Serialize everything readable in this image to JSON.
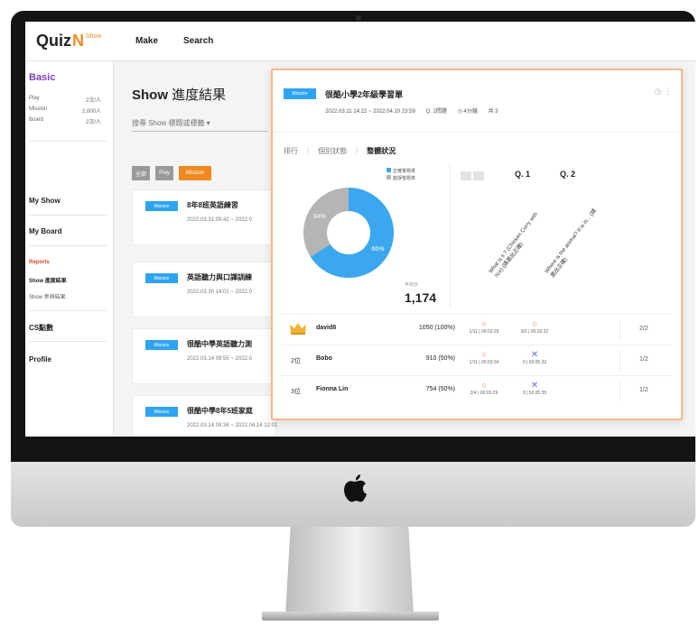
{
  "app": {
    "logo_text": "Quiz",
    "logo_mark": "N",
    "logo_badge": "Show",
    "nav": [
      "Make",
      "Search"
    ]
  },
  "sidebar": {
    "plan_title": "Basic",
    "plan_rows": [
      {
        "label": "Play",
        "value": "2次/人"
      },
      {
        "label": "Mission",
        "value": "2,000人"
      },
      {
        "label": "Board",
        "value": "2次/人"
      }
    ],
    "items": [
      "My Show",
      "My Board"
    ],
    "reports_label": "Reports",
    "report_subs": [
      "Show 進度結果",
      "Show 參與結果"
    ],
    "extra_items": [
      "CS點數",
      "Profile"
    ]
  },
  "main": {
    "title_prefix": "Show",
    "title_zh": "進度結果",
    "search_placeholder": "搜尋 Show 標題或標籤 ▾",
    "filters": [
      "全部",
      "Play",
      "Mission"
    ],
    "cards": [
      {
        "tag": "Mission",
        "title": "8年8班英語練習",
        "date": "2022.03.31 09:42 ~ 2022.0"
      },
      {
        "tag": "Mission",
        "title": "英語聽力與口譯訓練",
        "date": "2022.03.30 14:01 ~ 2022.0"
      },
      {
        "tag": "Mission",
        "title": "很酷中學英語聽力測",
        "date": "2022.03.14 09:55 ~ 2022.0"
      },
      {
        "tag": "Mission",
        "title": "很酷中學8年5班家庭",
        "date": "2022.03.14 09:36 ~ 2022.04.14 12:01"
      }
    ]
  },
  "report": {
    "tag": "Mission",
    "title": "很酷小學2年級學習單",
    "meta": [
      "2022.03.11 14:22 ~ 2022.04.10 23:59",
      "Q. 2問題",
      "◷ 4分鐘",
      "共 3"
    ],
    "menu_icon": "◷ ⋮",
    "tabs": [
      "排行",
      "個別狀態",
      "整體狀況"
    ],
    "active_tab_index": 2,
    "legend": [
      "正確答題率",
      "錯誤答題率"
    ],
    "avg_label": "平均分",
    "avg_value": "1,174",
    "question_heads": [
      "Q. 1",
      "Q. 2"
    ],
    "question_texts": [
      "What is it ? (Chicken Curry with rice) (請選出正確)",
      "Where is the animal? It is in... (請選出正確)"
    ],
    "rows": [
      {
        "rank": "",
        "name": "david8",
        "score": "1050 (100%)",
        "q1": {
          "mark": "○",
          "time": "1/11 | 00:03:29"
        },
        "q2": {
          "mark": "○",
          "time": "9/2 | 00:02:32"
        },
        "total": "2/2"
      },
      {
        "rank": "2位",
        "name": "Bobo",
        "score": "910 (50%)",
        "q1": {
          "mark": "○",
          "time": "1/11 | 00:03:34"
        },
        "q2": {
          "mark": "✕",
          "time": "0 | 00:05:32"
        },
        "total": "1/2"
      },
      {
        "rank": "3位",
        "name": "Fionna Lin",
        "score": "754 (50%)",
        "q1": {
          "mark": "○",
          "time": "2/4 | 00:03:29"
        },
        "q2": {
          "mark": "✕",
          "time": "0 | 00:05:35"
        },
        "total": "1/2"
      }
    ]
  },
  "chart_data": {
    "type": "pie",
    "labels": [
      "正確答題率",
      "錯誤答題率"
    ],
    "values": [
      66,
      34
    ],
    "value_labels": [
      "66%",
      "34%"
    ],
    "colors": [
      "#3aa7ee",
      "#b5b5b5"
    ],
    "legend_position": "top-right"
  },
  "colors": {
    "accent_orange": "#f08a1f",
    "mission_blue": "#2ea3f2",
    "plan_purple": "#7b3fc6",
    "reports_red": "#e0442f",
    "panel_border": "#f5b888"
  },
  "icons": {
    "crown": "crown-icon",
    "apple": "apple-logo-icon"
  }
}
